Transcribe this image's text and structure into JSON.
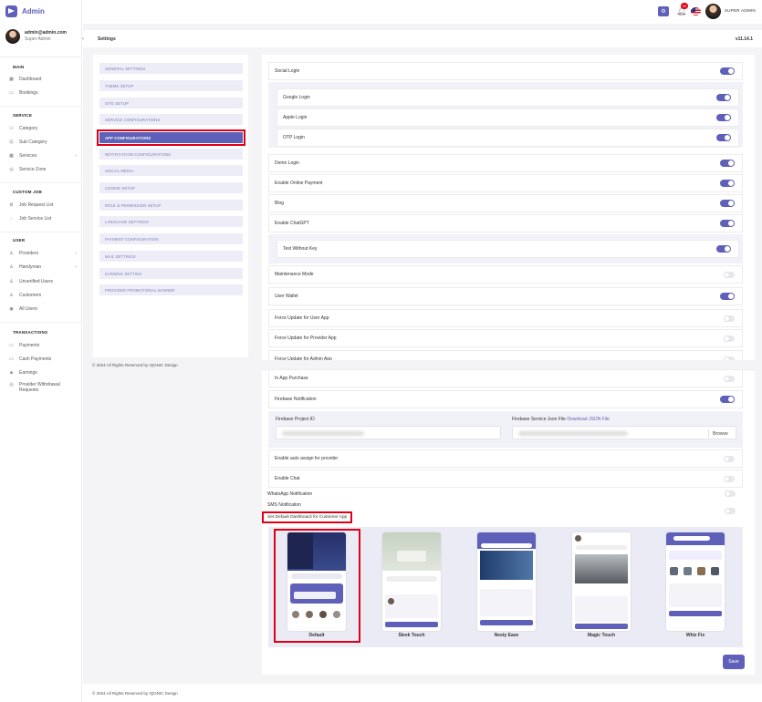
{
  "app": {
    "name": "Admin"
  },
  "user": {
    "email": "admin@admin.com",
    "role": "Super Admin"
  },
  "topbar": {
    "username": "SUPER ADMIN",
    "notif_count": "20"
  },
  "sidebar": {
    "sections": [
      {
        "title": "MAIN",
        "items": [
          "Dashboard",
          "Bookings"
        ]
      },
      {
        "title": "SERVICE",
        "items": [
          "Category",
          "Sub Category",
          "Services",
          "Service Zone"
        ]
      },
      {
        "title": "CUSTOM JOB",
        "items": [
          "Job Request List",
          "Job Service List"
        ]
      },
      {
        "title": "USER",
        "items": [
          "Providers",
          "Handyman",
          "Unverified Users",
          "Customers",
          "All Users"
        ]
      },
      {
        "title": "TRANSACTIONS",
        "items": [
          "Payments",
          "Cash Payments",
          "Earnings",
          "Provider Withdrawal Requests"
        ]
      }
    ]
  },
  "page": {
    "title": "Settings",
    "version": "v11.14.1"
  },
  "settings_menu": [
    "GENERAL SETTINGS",
    "THEME SETUP",
    "SITE SETUP",
    "SERVICE CONFIGURATIONS",
    "APP CONFIGURATIONS",
    "NOTIFICATION CONFIGURATIONS",
    "SOCIAL MEDIA",
    "COOKIE SETUP",
    "ROLE & PERMISSION SETUP",
    "LANGUAGE SETTINGS",
    "PAYMENT CONFIGURATION",
    "MAIL SETTINGS",
    "EARNING SETTING",
    "PROVIDER PROMOTIONAL BANNER"
  ],
  "settings_active": "APP CONFIGURATIONS",
  "toggles": {
    "social_login": "Social Login",
    "google_login": "Google Login",
    "apple_login": "Apple Login",
    "otp_login": "OTP Login",
    "demo_login": "Demo Login",
    "online_payment": "Enable Online Payment",
    "blog": "Blog",
    "chatgpt": "Enable ChatGPT",
    "test_without_key": "Test Without Key",
    "maintenance": "Maintenance Mode",
    "wallet": "User Wallet",
    "force_user": "Force Update for User App",
    "force_provider": "Force Update for Provider App",
    "force_admin": "Force Update for Admin App",
    "in_app_purchase": "In App Purchase",
    "firebase_notification": "Firebase Notification",
    "auto_assign": "Enable auto assign for provider",
    "chat": "Enable Chat",
    "whatsapp": "WhatsApp Notification",
    "sms": "SMS Notification"
  },
  "firebase": {
    "project_id_label": "Firebase Project ID",
    "json_label": "Firebase Service Json File",
    "download": "Download JSON File",
    "browse": "Browse"
  },
  "dashboard": {
    "label": "Set Default Dashboard for Customer App",
    "themes": [
      "Default",
      "Sleek Touch",
      "Nesty Ease",
      "Magic Touch",
      "Whiz Fix"
    ],
    "selected": "Default"
  },
  "buttons": {
    "save": "Save"
  },
  "footer": "© 2024 All Rights Reserved by IQONIC Design",
  "colors": {
    "accent": "#5f60b9",
    "highlight": "#e00016"
  }
}
